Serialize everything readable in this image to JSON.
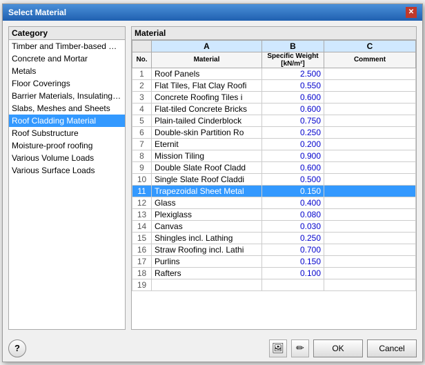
{
  "dialog": {
    "title": "Select Material",
    "close_label": "✕"
  },
  "category_panel": {
    "header": "Category",
    "items": [
      {
        "id": "timber",
        "label": "Timber and Timber-based Mater",
        "selected": false
      },
      {
        "id": "concrete",
        "label": "Concrete and Mortar",
        "selected": false
      },
      {
        "id": "metals",
        "label": "Metals",
        "selected": false
      },
      {
        "id": "floor",
        "label": "Floor Coverings",
        "selected": false
      },
      {
        "id": "barrier",
        "label": "Barrier Materials, Insulating Mate",
        "selected": false
      },
      {
        "id": "slabs",
        "label": "Slabs, Meshes and Sheets",
        "selected": false
      },
      {
        "id": "roof_cladding",
        "label": "Roof Cladding Material",
        "selected": true
      },
      {
        "id": "roof_sub",
        "label": "Roof Substructure",
        "selected": false
      },
      {
        "id": "moisture",
        "label": "Moisture-proof roofing",
        "selected": false
      },
      {
        "id": "volume",
        "label": "Various Volume Loads",
        "selected": false
      },
      {
        "id": "surface",
        "label": "Various Surface Loads",
        "selected": false
      }
    ]
  },
  "material_panel": {
    "header": "Material",
    "col_a_label": "A",
    "col_b_label": "B",
    "col_c_label": "C",
    "col_no_label": "No.",
    "col_material_label": "Material",
    "col_weight_label": "Specific Weight",
    "col_weight_unit": "[kN/m²]",
    "col_comment_label": "Comment",
    "rows": [
      {
        "no": 1,
        "material": "Roof Panels",
        "weight": "2.500",
        "comment": "",
        "selected": false
      },
      {
        "no": 2,
        "material": "Flat Tiles, Flat Clay Roofi",
        "weight": "0.550",
        "comment": "",
        "selected": false
      },
      {
        "no": 3,
        "material": "Concrete Roofing Tiles i",
        "weight": "0.600",
        "comment": "",
        "selected": false
      },
      {
        "no": 4,
        "material": "Flat-tiled Concrete Bricks",
        "weight": "0.600",
        "comment": "",
        "selected": false
      },
      {
        "no": 5,
        "material": "Plain-tailed Cinderblock",
        "weight": "0.750",
        "comment": "",
        "selected": false
      },
      {
        "no": 6,
        "material": "Double-skin Partition Ro",
        "weight": "0.250",
        "comment": "",
        "selected": false
      },
      {
        "no": 7,
        "material": "Eternit",
        "weight": "0.200",
        "comment": "",
        "selected": false
      },
      {
        "no": 8,
        "material": "Mission Tiling",
        "weight": "0.900",
        "comment": "",
        "selected": false
      },
      {
        "no": 9,
        "material": "Double Slate Roof Cladd",
        "weight": "0.600",
        "comment": "",
        "selected": false
      },
      {
        "no": 10,
        "material": "Single Slate Roof Claddi",
        "weight": "0.500",
        "comment": "",
        "selected": false
      },
      {
        "no": 11,
        "material": "Trapezoidal Sheet Metal",
        "weight": "0.150",
        "comment": "",
        "selected": true
      },
      {
        "no": 12,
        "material": "Glass",
        "weight": "0.400",
        "comment": "",
        "selected": false
      },
      {
        "no": 13,
        "material": "Plexiglass",
        "weight": "0.080",
        "comment": "",
        "selected": false
      },
      {
        "no": 14,
        "material": "Canvas",
        "weight": "0.030",
        "comment": "",
        "selected": false
      },
      {
        "no": 15,
        "material": "Shingles incl. Lathing",
        "weight": "0.250",
        "comment": "",
        "selected": false
      },
      {
        "no": 16,
        "material": "Straw Roofing incl. Lathi",
        "weight": "0.700",
        "comment": "",
        "selected": false
      },
      {
        "no": 17,
        "material": "Purlins",
        "weight": "0.150",
        "comment": "",
        "selected": false
      },
      {
        "no": 18,
        "material": "Rafters",
        "weight": "0.100",
        "comment": "",
        "selected": false
      },
      {
        "no": 19,
        "material": "",
        "weight": "",
        "comment": "",
        "selected": false
      }
    ]
  },
  "footer": {
    "help_label": "?",
    "icon1_label": "🖼",
    "icon2_label": "✏",
    "ok_label": "OK",
    "cancel_label": "Cancel"
  }
}
